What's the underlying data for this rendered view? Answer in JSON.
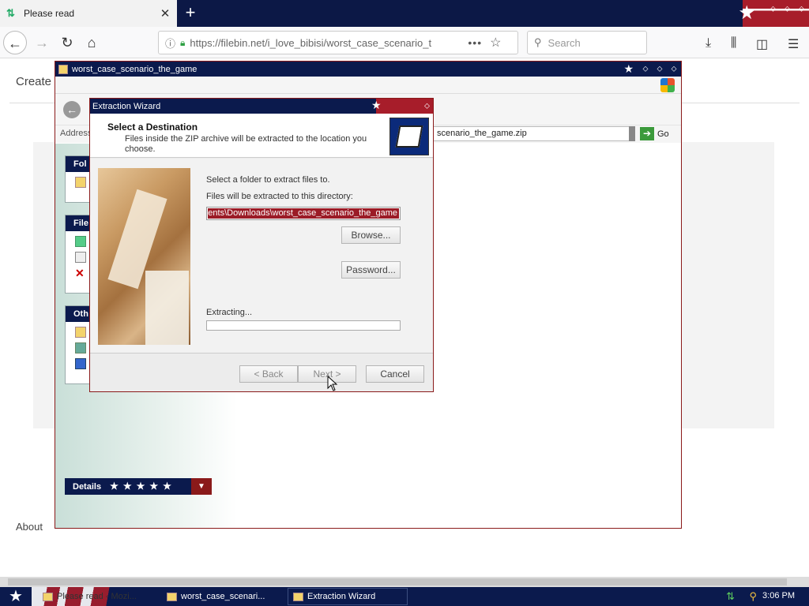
{
  "browser": {
    "tab_title": "Please read",
    "url": "https://filebin.net/i_love_bibisi/worst_case_scenario_t",
    "search_placeholder": "Search",
    "icons": [
      "back-arrow-icon",
      "forward-arrow-icon",
      "reload-icon",
      "home-icon",
      "info-icon",
      "lock-icon",
      "page-actions-icon",
      "bookmark-star-icon",
      "search-icon",
      "download-icon",
      "library-icon",
      "sidebar-icon",
      "menu-icon"
    ]
  },
  "webpage": {
    "create_text": "Create",
    "about_text": "About"
  },
  "explorer": {
    "title": "worst_case_scenario_the_game",
    "address_label": "Address",
    "address_value": "scenario_the_game.zip",
    "go_label": "Go",
    "details_label": "Details",
    "panels": [
      "Fol",
      "File",
      "Oth"
    ]
  },
  "wizard": {
    "title": "Extraction Wizard",
    "header_title": "Select a Destination",
    "header_subtitle": "Files inside the ZIP archive will be extracted to the location you choose.",
    "select_folder_label": "Select a folder to extract files to.",
    "directory_label": "Files will be extracted to this directory:",
    "directory_value": "ents\\Downloads\\worst_case_scenario_the_game",
    "browse_label": "Browse...",
    "password_label": "Password...",
    "extracting_label": "Extracting...",
    "progress_percent": 0,
    "back_label": "< Back",
    "next_label": "Next >",
    "cancel_label": "Cancel"
  },
  "taskbar": {
    "items": [
      "Please read - Mozi...",
      "worst_case_scenari...",
      "Extraction Wizard"
    ],
    "clock": "3:06 PM"
  }
}
